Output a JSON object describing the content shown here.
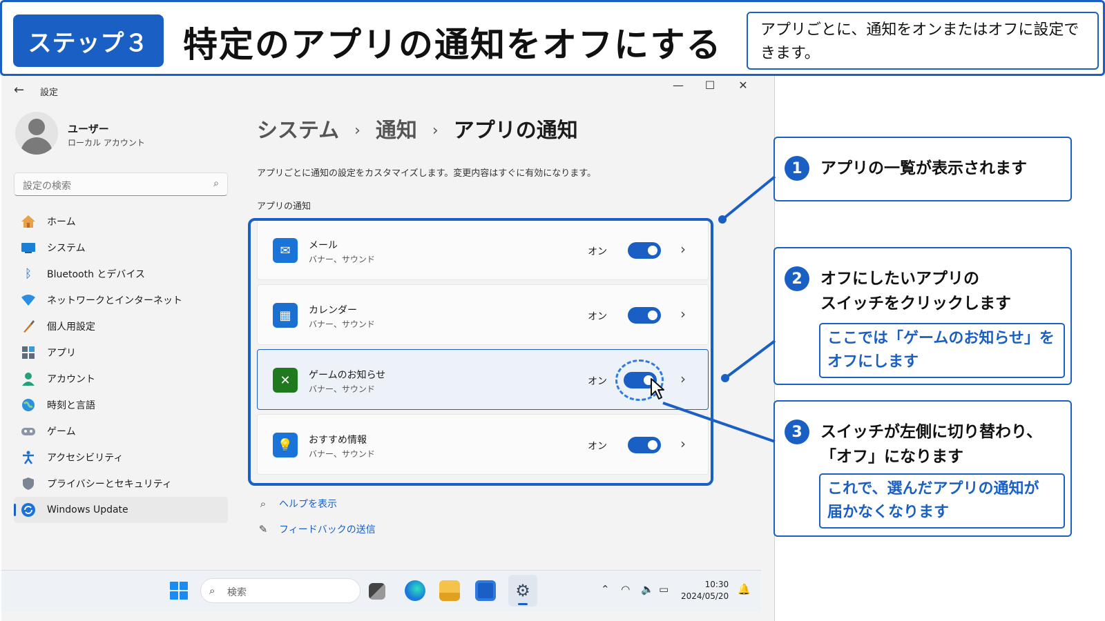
{
  "step": {
    "badge": "ステップ３",
    "title": "特定のアプリの通知をオフにする",
    "note": "アプリごとに、通知をオンまたはオフに設定できます。"
  },
  "window": {
    "title": "設定",
    "controls": {
      "minimize": "—",
      "maximize": "☐",
      "close": "✕"
    }
  },
  "profile": {
    "name": "ユーザー",
    "account": "ローカル アカウント"
  },
  "search": {
    "placeholder": "設定の検索"
  },
  "nav": [
    {
      "label": "ホーム",
      "icon": "home-icon"
    },
    {
      "label": "システム",
      "icon": "system-icon"
    },
    {
      "label": "Bluetooth とデバイス",
      "icon": "bluetooth-icon"
    },
    {
      "label": "ネットワークとインターネット",
      "icon": "network-icon"
    },
    {
      "label": "個人用設定",
      "icon": "brush-icon"
    },
    {
      "label": "アプリ",
      "icon": "apps-icon"
    },
    {
      "label": "アカウント",
      "icon": "account-icon"
    },
    {
      "label": "時刻と言語",
      "icon": "globe-icon"
    },
    {
      "label": "ゲーム",
      "icon": "gamepad-icon"
    },
    {
      "label": "アクセシビリティ",
      "icon": "accessibility-icon"
    },
    {
      "label": "プライバシーとセキュリティ",
      "icon": "shield-icon"
    },
    {
      "label": "Windows Update",
      "icon": "update-icon",
      "active": true
    }
  ],
  "breadcrumb": {
    "level1": "システム",
    "level2": "通知",
    "current": "アプリの通知",
    "separator": "›"
  },
  "description": "アプリごとに通知の設定をカスタマイズします。変更内容はすぐに有効になります。",
  "section_label": "アプリの通知",
  "apps": [
    {
      "name": "メール",
      "sub": "バナー、サウンド",
      "state": "オン",
      "on": true,
      "icon": "mail-icon",
      "color": "#1a73d9"
    },
    {
      "name": "カレンダー",
      "sub": "バナー、サウンド",
      "state": "オン",
      "on": true,
      "icon": "calendar-icon",
      "color": "#1a6fd0"
    },
    {
      "name": "ゲームのお知らせ",
      "sub": "バナー、サウンド",
      "state": "オン",
      "on": true,
      "icon": "xbox-icon",
      "color": "#1f7a1f"
    },
    {
      "name": "おすすめ情報",
      "sub": "バナー、サウンド",
      "state": "オン",
      "on": true,
      "icon": "lightbulb-icon",
      "color": "#1a73d9"
    }
  ],
  "links": {
    "help": "ヘルプを表示",
    "feedback": "フィードバックの送信"
  },
  "taskbar": {
    "search_placeholder": "検索",
    "time": "10:30",
    "date": "2024/05/20"
  },
  "callouts": {
    "c1": {
      "num": "1",
      "text": "アプリの一覧が表示されます"
    },
    "c2": {
      "num": "2",
      "line1": "オフにしたいアプリの",
      "line2": "スイッチをクリックします",
      "sub1": "ここでは「ゲームのお知らせ」を",
      "sub2": "オフにします"
    },
    "c3": {
      "num": "3",
      "line1": "スイッチが左側に切り替わり、",
      "line2": "「オフ」になります",
      "sub1": "これで、選んだアプリの通知が",
      "sub2": "届かなくなります"
    }
  },
  "colors": {
    "accent": "#1a5fc4",
    "highlight_ring": "#2f7ae0"
  }
}
